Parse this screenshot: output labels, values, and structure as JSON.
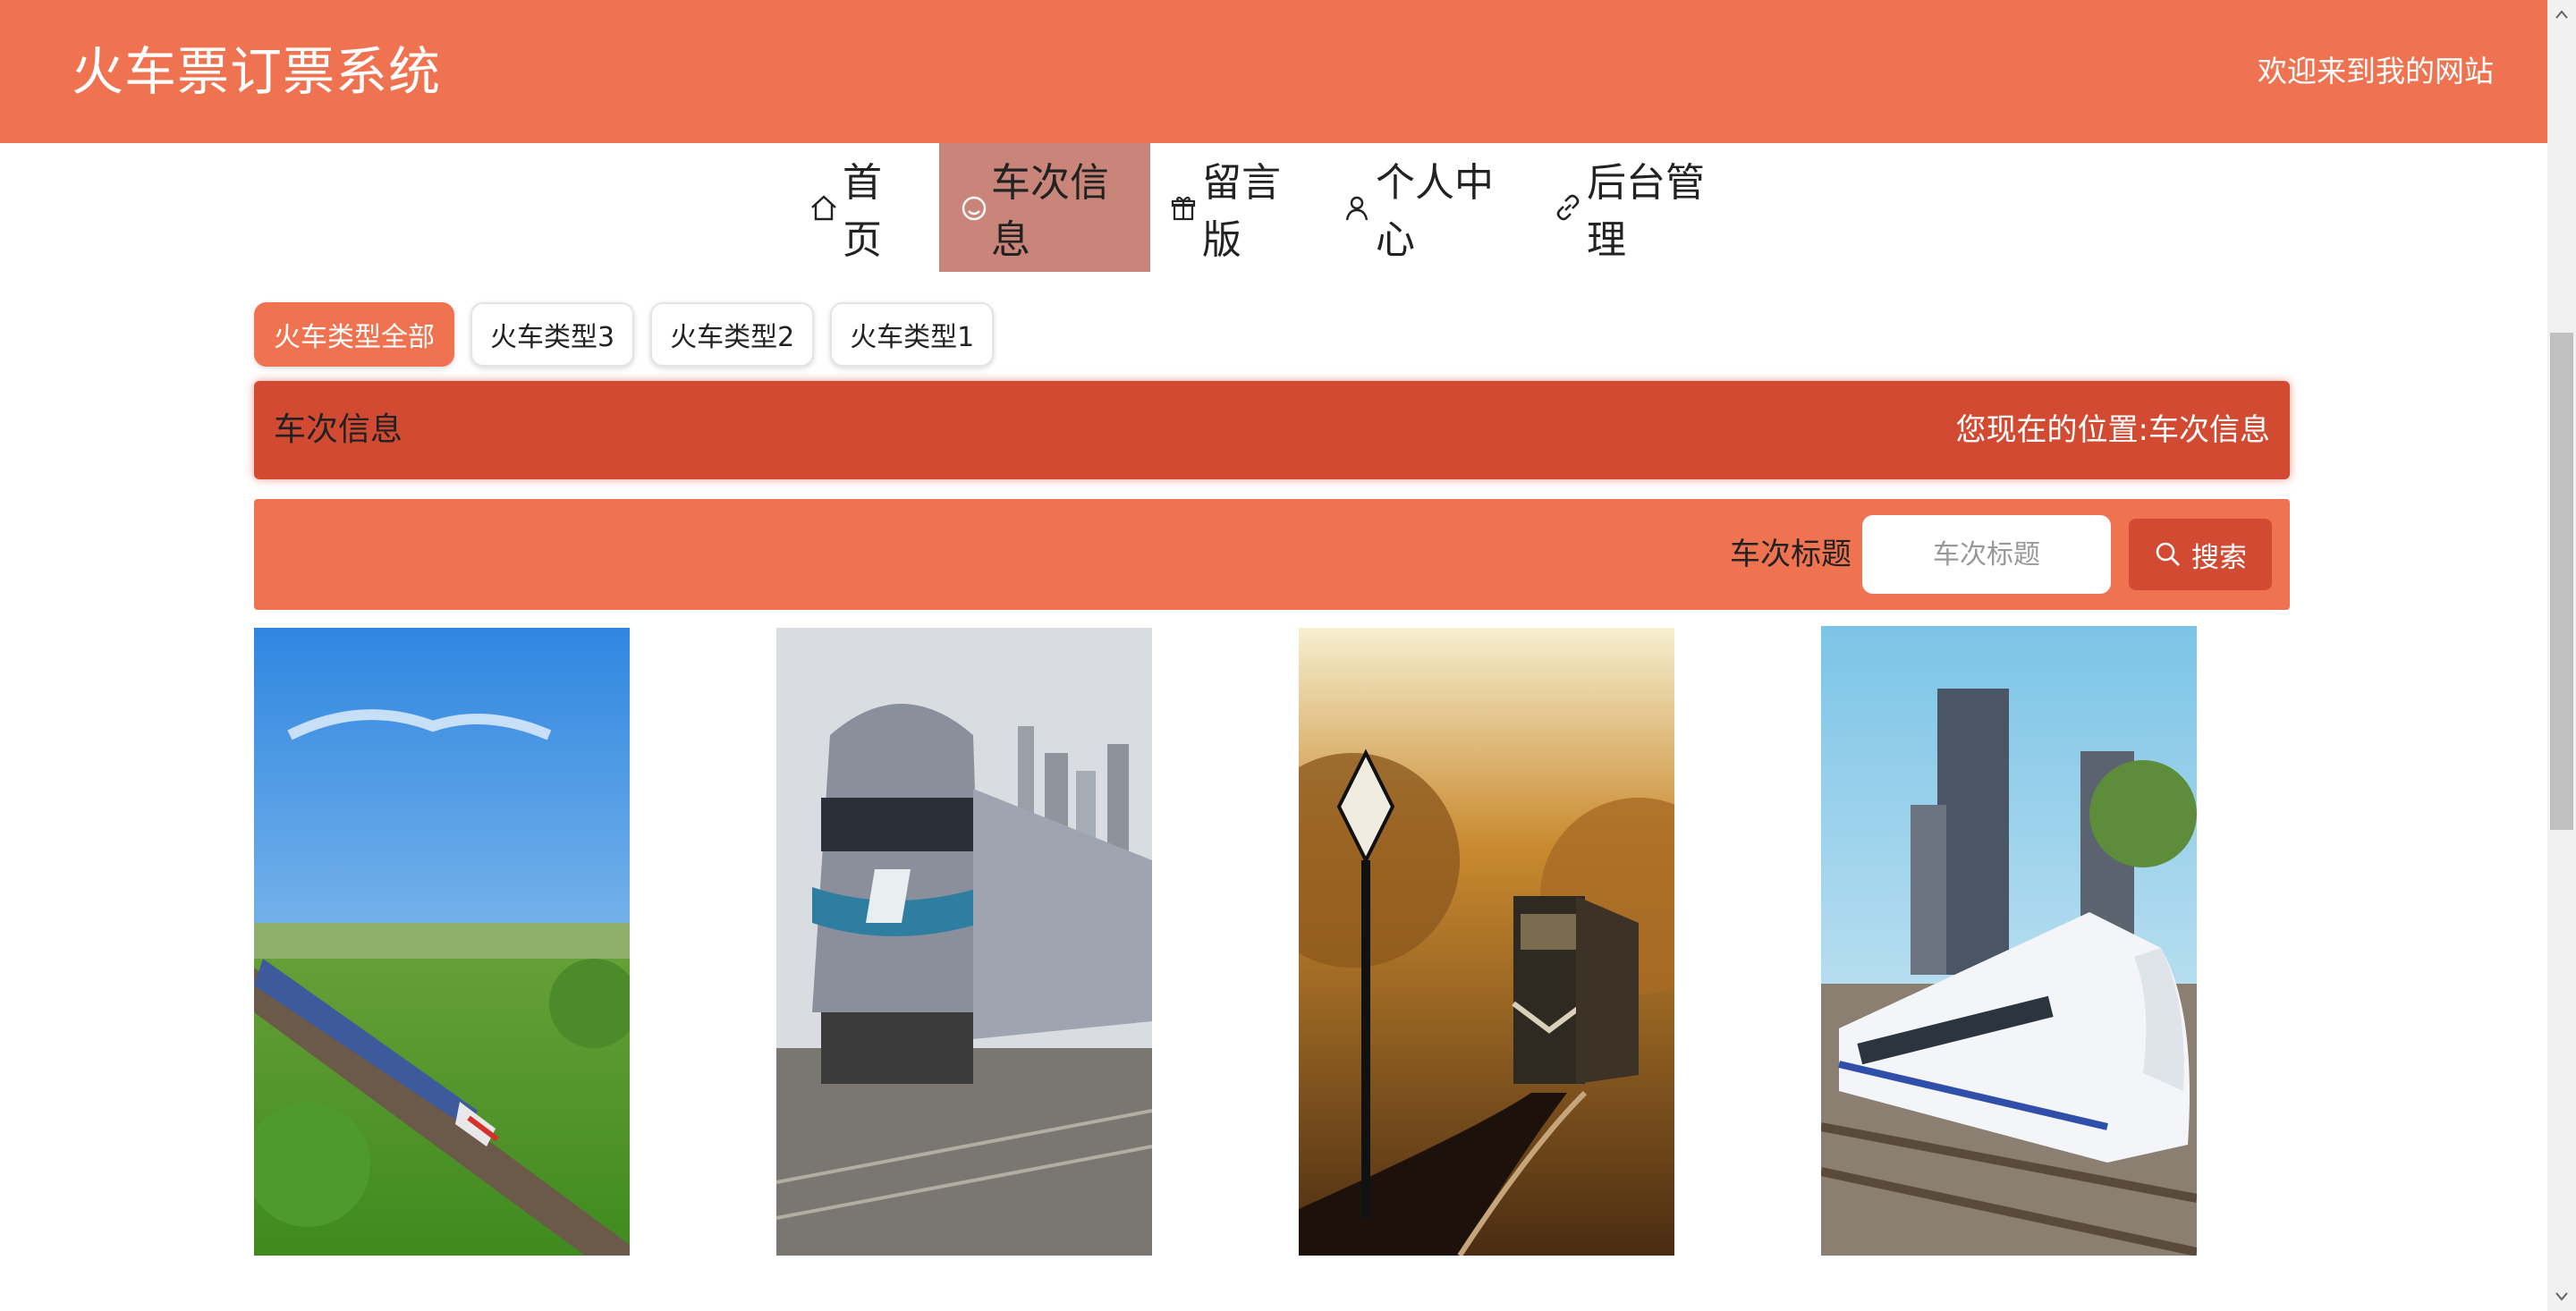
{
  "header": {
    "title": "火车票订票系统",
    "welcome": "欢迎来到我的网站"
  },
  "nav": {
    "items": [
      {
        "label": "首页",
        "icon": "home-icon"
      },
      {
        "label": "车次信息",
        "icon": "smile-icon",
        "active": true
      },
      {
        "label": "留言版",
        "icon": "gift-icon"
      },
      {
        "label": "个人中心",
        "icon": "user-icon"
      },
      {
        "label": "后台管理",
        "icon": "link-icon"
      }
    ]
  },
  "type_filter": {
    "items": [
      "火车类型全部",
      "火车类型3",
      "火车类型2",
      "火车类型1"
    ],
    "selected": "火车类型全部"
  },
  "location_bar": {
    "title": "车次信息",
    "path_prefix": "您现在的位置:",
    "path_current": "车次信息"
  },
  "search": {
    "label": "车次标题",
    "placeholder": "车次标题",
    "value": "",
    "button": "搜索"
  },
  "cards": [
    {
      "image": "high-speed-train-countryside"
    },
    {
      "image": "locomotive-city-skyline"
    },
    {
      "image": "train-autumn-forest"
    },
    {
      "image": "crh-train-railway"
    }
  ],
  "colors": {
    "primary": "#ef7351",
    "dark": "#d14a31",
    "nav_active_inner": "#c98579"
  }
}
